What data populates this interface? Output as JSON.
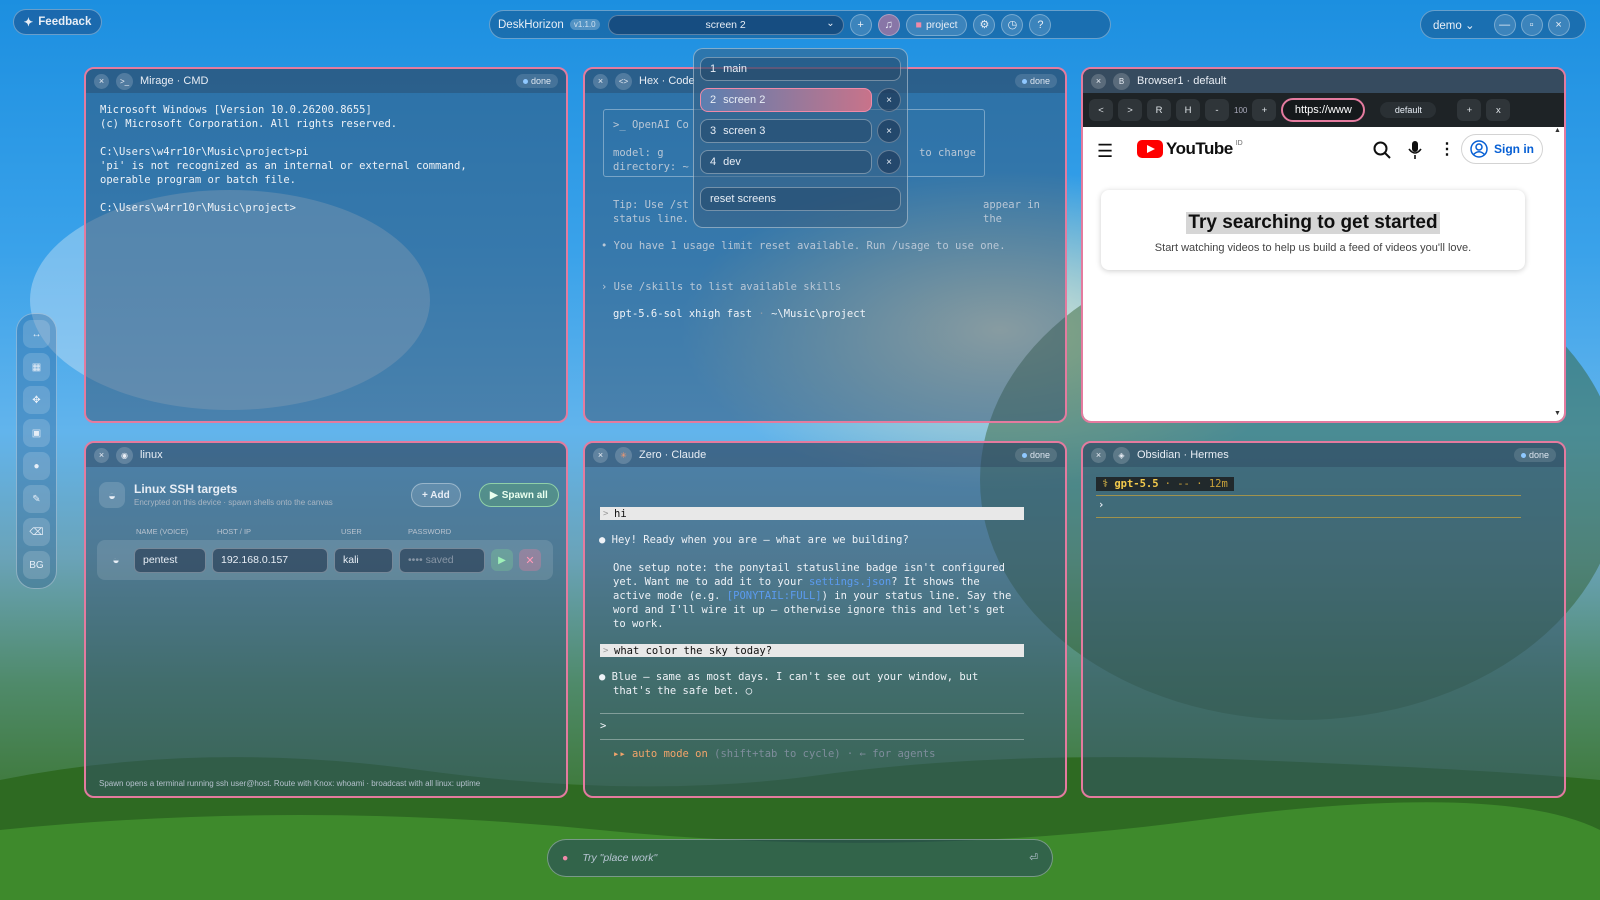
{
  "colors": {
    "accent_pink": "#e47b9f",
    "window_bg": "rgba(52,80,110,0.5)",
    "youtube_red": "#ff0000",
    "link_blue": "#3b82f6"
  },
  "topbar": {
    "feedback": "Feedback",
    "app_name": "DeskHorizon",
    "version": "v1.1.0",
    "screen_select": "screen 2",
    "project_label": "project",
    "user": "demo",
    "icons": [
      "plus-icon",
      "music-icon",
      "folder-icon",
      "gear-icon",
      "clock-icon",
      "help-icon",
      "minimize-icon",
      "maximize-icon",
      "close-icon"
    ]
  },
  "screens_menu": {
    "items": [
      {
        "num": "1",
        "label": "main",
        "active": false
      },
      {
        "num": "2",
        "label": "screen 2",
        "active": true
      },
      {
        "num": "3",
        "label": "screen 3",
        "active": false
      },
      {
        "num": "4",
        "label": "dev",
        "active": false
      }
    ],
    "reset": "reset screens",
    "close_glyph": "×"
  },
  "sidebar": {
    "last": "BG"
  },
  "cmd": {
    "title": "Mirage · CMD",
    "status": "done",
    "lines": "Microsoft Windows [Version 10.0.26200.8655]\n(c) Microsoft Corporation. All rights reserved.\n\nC:\\Users\\w4rr10r\\Music\\project>pi\n'pi' is not recognized as an internal or external command,\noperable program or batch file.\n\nC:\\Users\\w4rr10r\\Music\\project>"
  },
  "codex": {
    "title": "Hex · Code",
    "status": "done",
    "box_title": ">_ OpenAI Co",
    "box_model": "model:     g",
    "box_dir": "directory: ~",
    "box_change": "to change",
    "tip1": "Tip: Use /st",
    "tip1b": "appear in the",
    "tip2": "status line.",
    "usage": "• You have 1 usage limit reset available. Run /usage to use one.",
    "skills": "› Use /skills to list available skills",
    "model_line": "gpt-5.6-sol xhigh fast",
    "model_path": "~\\Music\\project"
  },
  "browser": {
    "title": "Browser1 · default",
    "buttons": [
      "<",
      ">",
      "R",
      "H",
      "-",
      "100",
      "+"
    ],
    "url": "https://www",
    "profile": "default",
    "add": "+",
    "close": "x",
    "yt_logo": "YouTube",
    "yt_country": "ID",
    "sign_in": "Sign in",
    "empty_title": "Try searching to get started",
    "empty_sub": "Start watching videos to help us build a feed of videos you'll love."
  },
  "linux": {
    "title": "linux",
    "heading": "Linux SSH targets",
    "sub": "Encrypted on this device · spawn shells onto the canvas",
    "add": "+ Add",
    "spawn_all": "Spawn all",
    "cols": [
      "NAME (VOICE)",
      "HOST / IP",
      "USER",
      "PASSWORD"
    ],
    "row": {
      "name": "pentest",
      "host": "192.168.0.157",
      "user": "kali",
      "password": "•••• saved"
    },
    "footer": "Spawn opens a terminal running ssh user@host. Route with  Knox: whoami  ·  broadcast with  all linux: uptime"
  },
  "claude": {
    "title": "Zero · Claude",
    "status": "done",
    "msg1": "hi",
    "reply1": "Hey! Ready when you are — what are we building?",
    "note_a": "One setup note: the ponytail statusline badge isn't configured",
    "note_b": "yet. Want me to add it to your ",
    "note_link": "settings.json",
    "note_c": "? It shows the",
    "note_d": "active mode (e.g. ",
    "note_badge": "[PONYTAIL:FULL]",
    "note_e": ") in your status line. Say the",
    "note_f": "word and I'll wire it up — otherwise ignore this and let's get",
    "note_g": "to work.",
    "msg2": "what color the sky today?",
    "reply2a": "Blue — same as most days. I can't see out your window, but",
    "reply2b": "that's the safe bet.",
    "prompt": ">",
    "mode": "▸▸ auto mode on",
    "mode_hint": "(shift+tab to cycle) · ← for agents"
  },
  "obsidian": {
    "title": "Obsidian · Hermes",
    "status": "done",
    "model": "gpt-5.5",
    "meta": "· -- · 12m",
    "prompt": "›"
  },
  "chatbar": {
    "placeholder": "Try \"place work\""
  }
}
